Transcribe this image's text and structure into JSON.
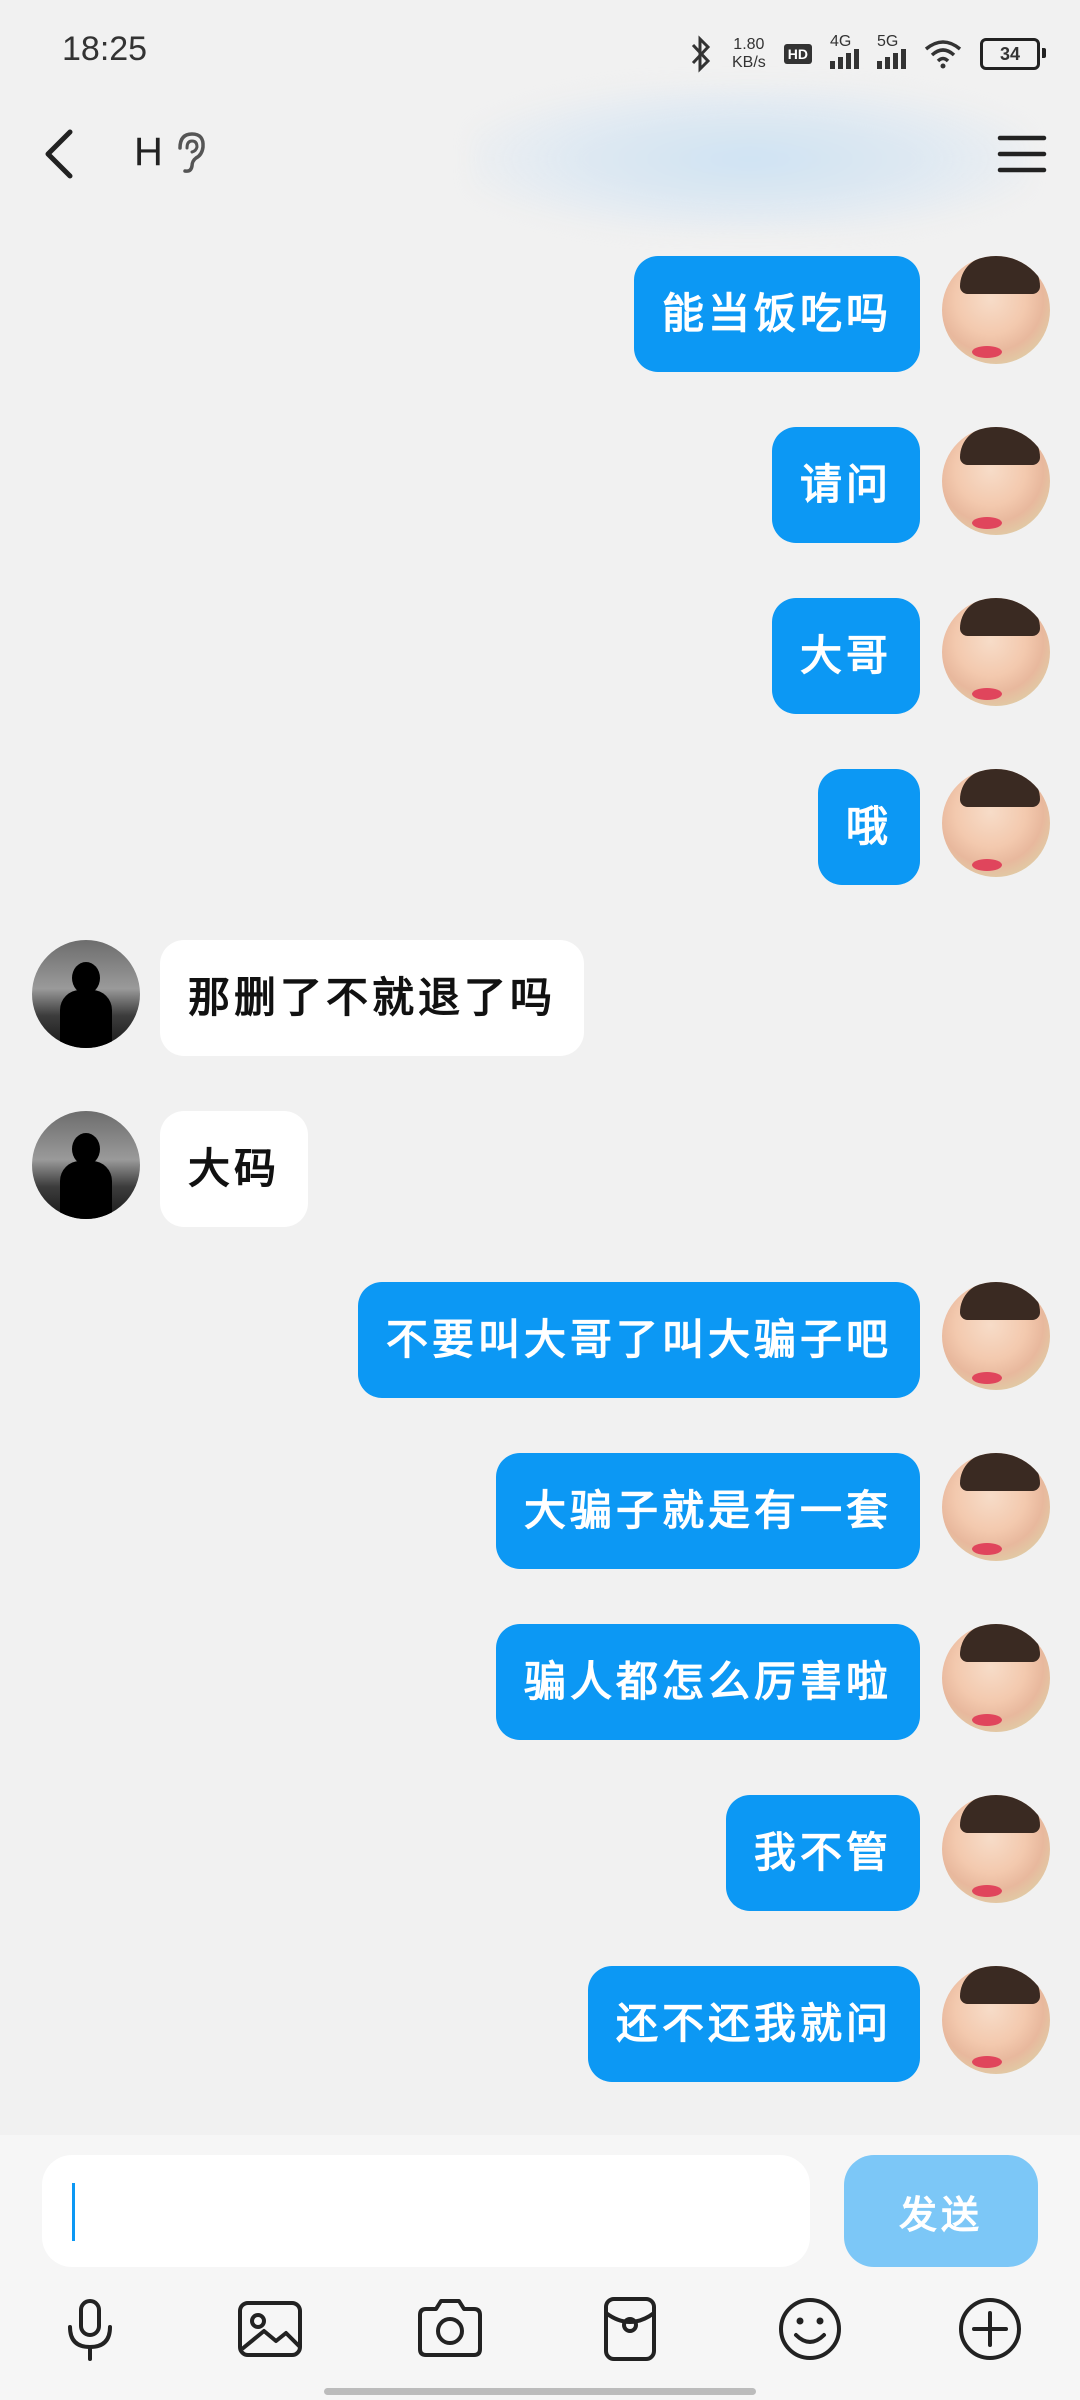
{
  "status_bar": {
    "time": "18:25",
    "net_speed_value": "1.80",
    "net_speed_unit": "KB/s",
    "hd_label": "HD",
    "sim1_label": "4G",
    "sim2_label": "5G",
    "battery": "34",
    "icons": [
      "bluetooth-icon",
      "hd-volte-icon",
      "signal-4g-icon",
      "signal-5g-icon",
      "wifi-icon",
      "battery-icon"
    ]
  },
  "header": {
    "contact_name": "H",
    "back_icon": "chevron-left-icon",
    "ear_icon": "ear-icon",
    "menu_icon": "hamburger-menu-icon"
  },
  "messages": [
    {
      "from": "me",
      "text": "能当饭吃吗"
    },
    {
      "from": "me",
      "text": "请问"
    },
    {
      "from": "me",
      "text": "大哥"
    },
    {
      "from": "me",
      "text": "哦"
    },
    {
      "from": "other",
      "text": "那删了不就退了吗"
    },
    {
      "from": "other",
      "text": "大码"
    },
    {
      "from": "me",
      "text": "不要叫大哥了叫大骗子吧"
    },
    {
      "from": "me",
      "text": "大骗子就是有一套"
    },
    {
      "from": "me",
      "text": "骗人都怎么厉害啦"
    },
    {
      "from": "me",
      "text": "我不管"
    },
    {
      "from": "me",
      "text": "还不还我就问"
    }
  ],
  "composer": {
    "input_value": "",
    "send_label": "发送",
    "tools": [
      "microphone-icon",
      "image-icon",
      "camera-icon",
      "red-packet-icon",
      "emoji-icon",
      "plus-icon"
    ]
  },
  "colors": {
    "bubble_me": "#0c98f4",
    "bubble_other": "#ffffff",
    "send_button": "#7cc7f7",
    "background": "#f1f1f1"
  }
}
